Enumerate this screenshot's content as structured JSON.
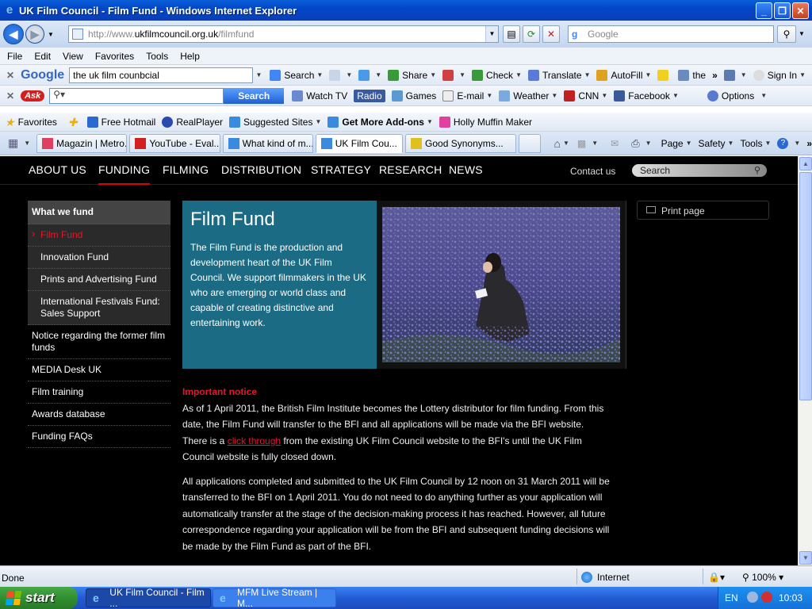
{
  "window": {
    "title": "UK Film Council - Film Fund - Windows Internet Explorer",
    "minimize": "_",
    "restore": "❐",
    "close": "✕"
  },
  "address": {
    "url_prefix": "http://www.",
    "url_domain": "ukfilmcouncil.org.uk",
    "url_path": "/filmfund",
    "search_placeholder": "Google"
  },
  "menu": [
    "File",
    "Edit",
    "View",
    "Favorites",
    "Tools",
    "Help"
  ],
  "google_toolbar": {
    "logo": "Google",
    "query": "the uk film counbcial",
    "items": [
      "Search",
      "Share",
      "Check",
      "Translate",
      "AutoFill",
      "the",
      "Sign In"
    ]
  },
  "ask_toolbar": {
    "logo": "Ask",
    "search_button": "Search",
    "items": [
      "Watch TV",
      "Radio",
      "Games",
      "E-mail",
      "Weather",
      "CNN",
      "Facebook"
    ],
    "options": "Options"
  },
  "favorites_bar": {
    "favorites_label": "Favorites",
    "items": [
      "Free Hotmail",
      "RealPlayer",
      "Suggested Sites",
      "Get More Add-ons",
      "Holly Muffin Maker"
    ]
  },
  "tabs": [
    {
      "label": "Magazin | Metro...",
      "active": false
    },
    {
      "label": "YouTube - Eval...",
      "active": false
    },
    {
      "label": "What kind of m...",
      "active": false
    },
    {
      "label": "UK Film Cou...",
      "active": true
    },
    {
      "label": "Good Synonyms...",
      "active": false
    }
  ],
  "command_bar": [
    "Page",
    "Safety",
    "Tools"
  ],
  "site": {
    "nav": [
      "ABOUT US",
      "FUNDING",
      "FILMING",
      "DISTRIBUTION",
      "STRATEGY",
      "RESEARCH",
      "NEWS"
    ],
    "active_nav": "FUNDING",
    "contact": "Contact us",
    "search_placeholder": "Search",
    "left_nav": {
      "heading": "What we fund",
      "active": "Film Fund",
      "sub": [
        "Innovation Fund",
        "Prints and Advertising Fund",
        "International Festivals Fund: Sales Support"
      ],
      "items": [
        "Notice regarding the former film funds",
        "MEDIA Desk UK",
        "Film training",
        "Awards database",
        "Funding FAQs"
      ]
    },
    "hero": {
      "title": "Film Fund",
      "body": "The Film Fund is the production and development heart of the UK Film Council. We support filmmakers in the UK who are emerging or world class and capable of creating distinctive and entertaining work."
    },
    "print": "Print page",
    "notice_heading": "Important notice",
    "para1_a": "As of 1 April 2011, the British Film Institute becomes the Lottery distributor for film funding.  From this date, the Film Fund will transfer to the BFI and all applications will be made via the BFI website. There is a ",
    "para1_link": "click through",
    "para1_b": " from the existing UK Film Council website to the BFI's until the UK Film Council website is fully closed down.",
    "para2": "All applications completed and submitted to the UK Film Council by 12 noon on 31 March 2011 will be transferred to the BFI on 1 April 2011. You do not need to do anything further as your application will automatically transfer at the stage of the decision-making process it has reached.  However, all future correspondence regarding your application will be from the BFI and subsequent funding decisions will be made by the Film Fund as part of the BFI."
  },
  "status": {
    "text": "Done",
    "zone": "Internet",
    "zoom": "100%"
  },
  "taskbar": {
    "start": "start",
    "buttons": [
      {
        "label": "UK Film Council - Film ...",
        "active": true
      },
      {
        "label": "MFM Live Stream | M...",
        "active": false
      }
    ],
    "lang": "EN",
    "clock": "10:03"
  }
}
